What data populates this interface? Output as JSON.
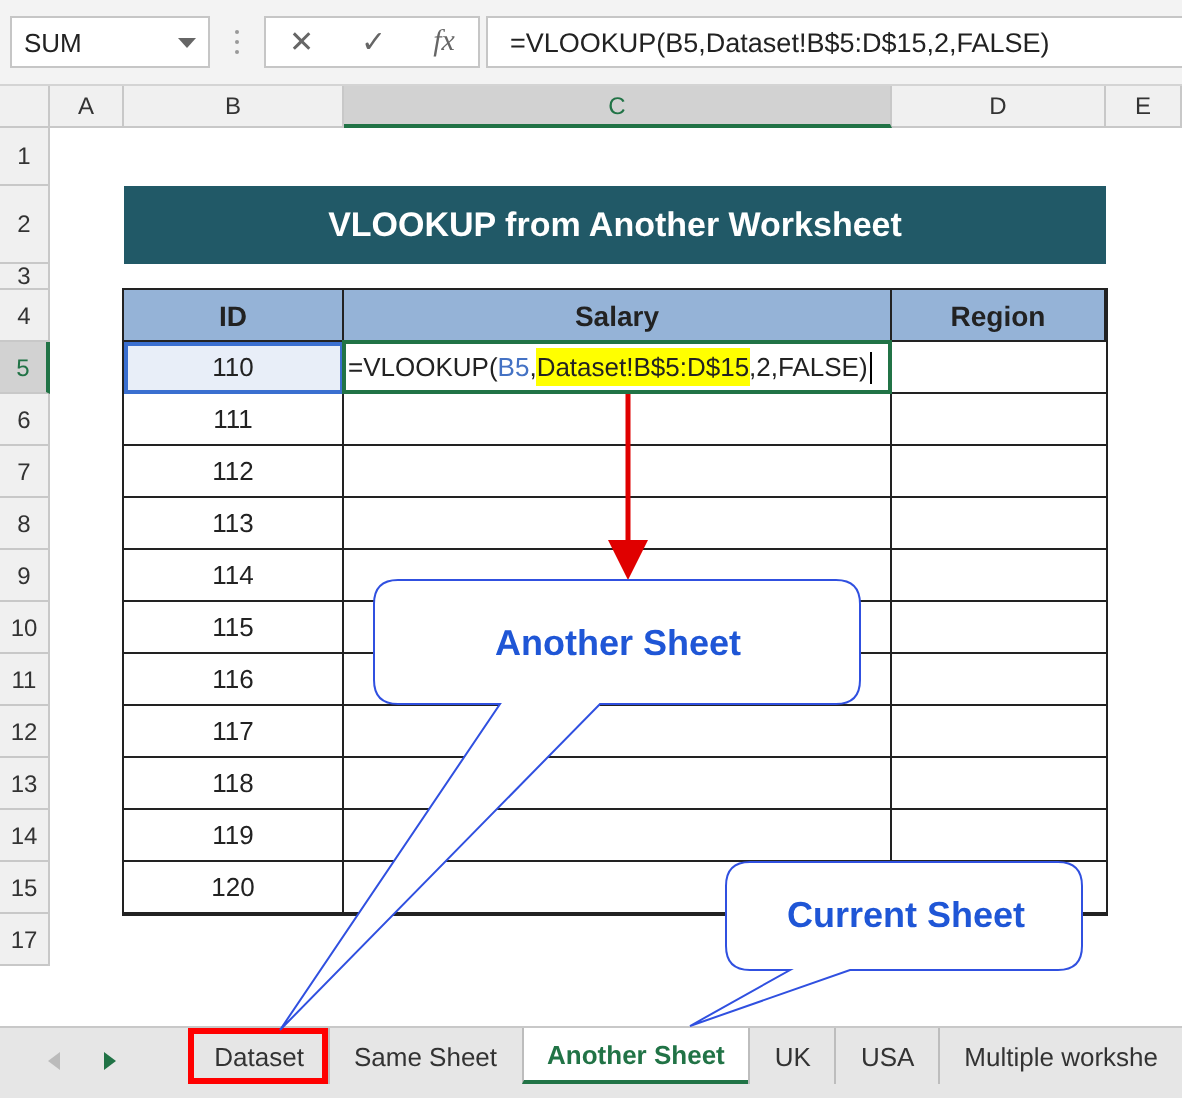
{
  "formula_bar": {
    "name_box": "SUM",
    "cancel_symbol": "✕",
    "enter_symbol": "✓",
    "function_symbol": "fx",
    "formula": "=VLOOKUP(B5,Dataset!B$5:D$15,2,FALSE)"
  },
  "columns": [
    {
      "label": "A",
      "selected": false
    },
    {
      "label": "B",
      "selected": false
    },
    {
      "label": "C",
      "selected": true
    },
    {
      "label": "D",
      "selected": false
    },
    {
      "label": "E",
      "selected": false
    }
  ],
  "rows": [
    {
      "label": "1",
      "selected": false
    },
    {
      "label": "2",
      "selected": false
    },
    {
      "label": "3",
      "selected": false
    },
    {
      "label": "4",
      "selected": false
    },
    {
      "label": "5",
      "selected": true
    },
    {
      "label": "6",
      "selected": false
    },
    {
      "label": "7",
      "selected": false
    },
    {
      "label": "8",
      "selected": false
    },
    {
      "label": "9",
      "selected": false
    },
    {
      "label": "10",
      "selected": false
    },
    {
      "label": "11",
      "selected": false
    },
    {
      "label": "12",
      "selected": false
    },
    {
      "label": "13",
      "selected": false
    },
    {
      "label": "14",
      "selected": false
    },
    {
      "label": "15",
      "selected": false
    },
    {
      "label": "17",
      "selected": false
    }
  ],
  "title": "VLOOKUP from Another Worksheet",
  "table": {
    "columns": [
      "ID",
      "Salary",
      "Region"
    ],
    "ids": [
      "110",
      "111",
      "112",
      "113",
      "114",
      "115",
      "116",
      "117",
      "118",
      "119",
      "120"
    ],
    "editing_formula": [
      {
        "kind": "plain",
        "text": "=VLOOKUP("
      },
      {
        "kind": "ref",
        "text": "B5"
      },
      {
        "kind": "plain",
        "text": ","
      },
      {
        "kind": "range",
        "text": "Dataset!B$5:D$15"
      },
      {
        "kind": "plain",
        "text": ",2,FALSE)"
      }
    ]
  },
  "callouts": [
    {
      "text": "Another Sheet"
    },
    {
      "text": "Current Sheet"
    }
  ],
  "sheet_tabs": [
    {
      "label": "Dataset",
      "selected": false,
      "outlined": true
    },
    {
      "label": "Same Sheet",
      "selected": false,
      "outlined": false
    },
    {
      "label": "Another Sheet",
      "selected": true,
      "outlined": false
    },
    {
      "label": "UK",
      "selected": false,
      "outlined": false
    },
    {
      "label": "USA",
      "selected": false,
      "outlined": false
    },
    {
      "label": "Multiple workshe",
      "selected": false,
      "outlined": false
    }
  ]
}
